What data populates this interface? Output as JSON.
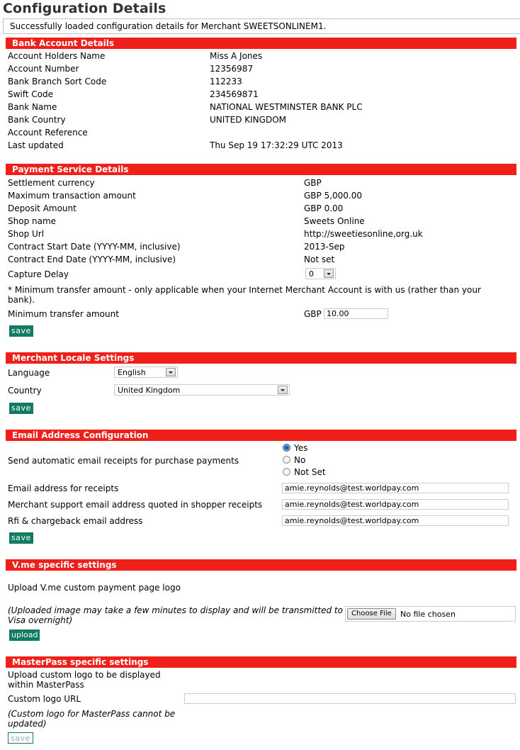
{
  "page_title": "Configuration Details",
  "status_message": "Successfully loaded configuration details for Merchant SWEETSONLINEM1.",
  "bank": {
    "header": "Bank Account Details",
    "rows": [
      {
        "label": "Account Holders Name",
        "value": "Miss A Jones"
      },
      {
        "label": "Account Number",
        "value": "12356987"
      },
      {
        "label": "Bank Branch Sort Code",
        "value": "112233"
      },
      {
        "label": "Swift Code",
        "value": "234569871"
      },
      {
        "label": "Bank Name",
        "value": "NATIONAL WESTMINSTER BANK PLC"
      },
      {
        "label": "Bank Country",
        "value": "UNITED KINGDOM"
      },
      {
        "label": "Account Reference",
        "value": ""
      },
      {
        "label": "Last updated",
        "value": "Thu Sep 19 17:32:29 UTC 2013"
      }
    ]
  },
  "payment": {
    "header": "Payment Service Details",
    "rows": [
      {
        "label": "Settlement currency",
        "value": "GBP"
      },
      {
        "label": "Maximum transaction amount",
        "value": "GBP 5,000.00"
      },
      {
        "label": "Deposit Amount",
        "value": "GBP 0.00"
      },
      {
        "label": "Shop name",
        "value": "Sweets Online"
      },
      {
        "label": "Shop Url",
        "value": "http://sweetiesonline,org.uk"
      },
      {
        "label": "Contract Start Date (YYYY-MM, inclusive)",
        "value": "2013-Sep"
      },
      {
        "label": "Contract End Date (YYYY-MM, inclusive)",
        "value": "Not set"
      }
    ],
    "capture_delay_label": "Capture Delay",
    "capture_delay_value": "0",
    "note_line1": "* Minimum transfer amount - only applicable when your Internet Merchant Account is with us (rather than your",
    "note_line2": "bank).",
    "min_transfer_label": "Minimum transfer amount",
    "min_transfer_currency": "GBP",
    "min_transfer_value": "10.00",
    "save_label": "save"
  },
  "locale": {
    "header": "Merchant Locale Settings",
    "language_label": "Language",
    "language_value": "English",
    "country_label": "Country",
    "country_value": "United Kingdom",
    "save_label": "save"
  },
  "email": {
    "header": "Email Address Configuration",
    "receipts_question": "Send automatic email receipts for purchase payments",
    "options": [
      {
        "label": "Yes",
        "checked": true
      },
      {
        "label": "No",
        "checked": false
      },
      {
        "label": "Not Set",
        "checked": false
      }
    ],
    "fields": [
      {
        "label": "Email address for receipts",
        "value": "amie.reynolds@test.worldpay.com"
      },
      {
        "label": "Merchant support email address quoted in shopper receipts",
        "value": "amie.reynolds@test.worldpay.com"
      },
      {
        "label": "Rfi & chargeback email address",
        "value": "amie.reynolds@test.worldpay.com"
      }
    ],
    "save_label": "save"
  },
  "vme": {
    "header": "V.me specific settings",
    "upload_label": "Upload V.me custom payment page logo",
    "note_line1": "(Uploaded image may take a few minutes to display and will be transmitted to",
    "note_line2": "Visa overnight)",
    "choose_file_label": "Choose File",
    "file_status": "No file chosen",
    "upload_button": "upload"
  },
  "masterpass": {
    "header": "MasterPass specific settings",
    "upload_line1": "Upload custom logo to be displayed",
    "upload_line2": "within MasterPass",
    "url_label": "Custom logo URL",
    "url_value": "",
    "note_line1": "(Custom logo for MasterPass cannot be",
    "note_line2": "updated)",
    "save_label": "save"
  },
  "colors": {
    "section_header": "#f01f19",
    "button": "#127b62"
  }
}
